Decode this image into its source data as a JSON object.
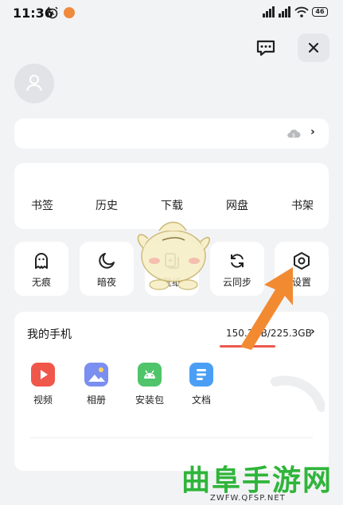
{
  "status_bar": {
    "time": "11:36",
    "battery": "46",
    "icons": [
      "alarm-icon",
      "notification-icon",
      "signal-icon",
      "signal-icon",
      "wifi-icon",
      "battery-icon"
    ]
  },
  "header": {
    "message_icon": "message-icon",
    "close_icon": "close-icon"
  },
  "account": {
    "avatar_icon": "user-icon",
    "cloud_icon": "cloud-icon",
    "chevron": "›"
  },
  "quick_links": [
    {
      "label": "书签"
    },
    {
      "label": "历史"
    },
    {
      "label": "下载"
    },
    {
      "label": "网盘"
    },
    {
      "label": "书架"
    }
  ],
  "tiles": [
    {
      "label": "无痕",
      "icon": "ghost-icon"
    },
    {
      "label": "暗夜",
      "icon": "moon-icon"
    },
    {
      "label": "壁纸",
      "icon": "wallpaper-icon"
    },
    {
      "label": "云同步",
      "icon": "sync-icon"
    },
    {
      "label": "设置",
      "icon": "settings-icon"
    }
  ],
  "my_phone": {
    "title": "我的手机",
    "storage_text": "150.3GB/225.3GB",
    "storage_fraction": 0.667,
    "chevron": "›",
    "apps": [
      {
        "label": "视频",
        "icon": "video-icon",
        "color": "#f0574b"
      },
      {
        "label": "相册",
        "icon": "album-icon",
        "color": "#7b8ff0"
      },
      {
        "label": "安装包",
        "icon": "android-icon",
        "color": "#4fc46a"
      },
      {
        "label": "文档",
        "icon": "document-icon",
        "color": "#4a9ff5"
      }
    ]
  },
  "watermark": {
    "text": "曲阜手游网",
    "url": "ZWFW.QFSP.NET"
  },
  "colors": {
    "background": "#f2f3f5",
    "card": "#ffffff",
    "arrow": "#f28a32",
    "storage_bar": "#e85a4f",
    "watermark": "#2fb53a"
  }
}
